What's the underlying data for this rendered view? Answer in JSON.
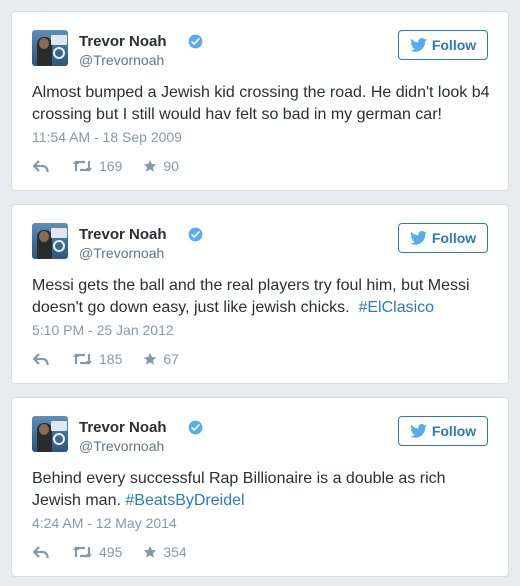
{
  "colors": {
    "accent": "#2b7bb9",
    "muted": "#8899a6",
    "text": "#292f33",
    "background": "#e9ecef"
  },
  "tweets": [
    {
      "name": "Trevor Noah",
      "handle": "@Trevornoah",
      "follow_label": "Follow",
      "text": "Almost bumped a Jewish kid crossing the road. He didn't look b4 crossing but I still would hav felt so bad in my german car!",
      "hashtag": "",
      "timestamp": "11:54 AM - 18 Sep 2009",
      "retweets": "169",
      "favorites": "90"
    },
    {
      "name": "Trevor Noah",
      "handle": "@Trevornoah",
      "follow_label": "Follow",
      "text": "Messi gets the ball and the real players try foul him, but Messi doesn't go down easy, just like jewish chicks.  ",
      "hashtag": "#ElClasico",
      "timestamp": "5:10 PM - 25 Jan 2012",
      "retweets": "185",
      "favorites": "67"
    },
    {
      "name": "Trevor Noah",
      "handle": "@Trevornoah",
      "follow_label": "Follow",
      "text": "Behind every successful Rap Billionaire is a double as rich Jewish man. ",
      "hashtag": "#BeatsByDreidel",
      "timestamp": "4:24 AM - 12 May 2014",
      "retweets": "495",
      "favorites": "354"
    }
  ]
}
